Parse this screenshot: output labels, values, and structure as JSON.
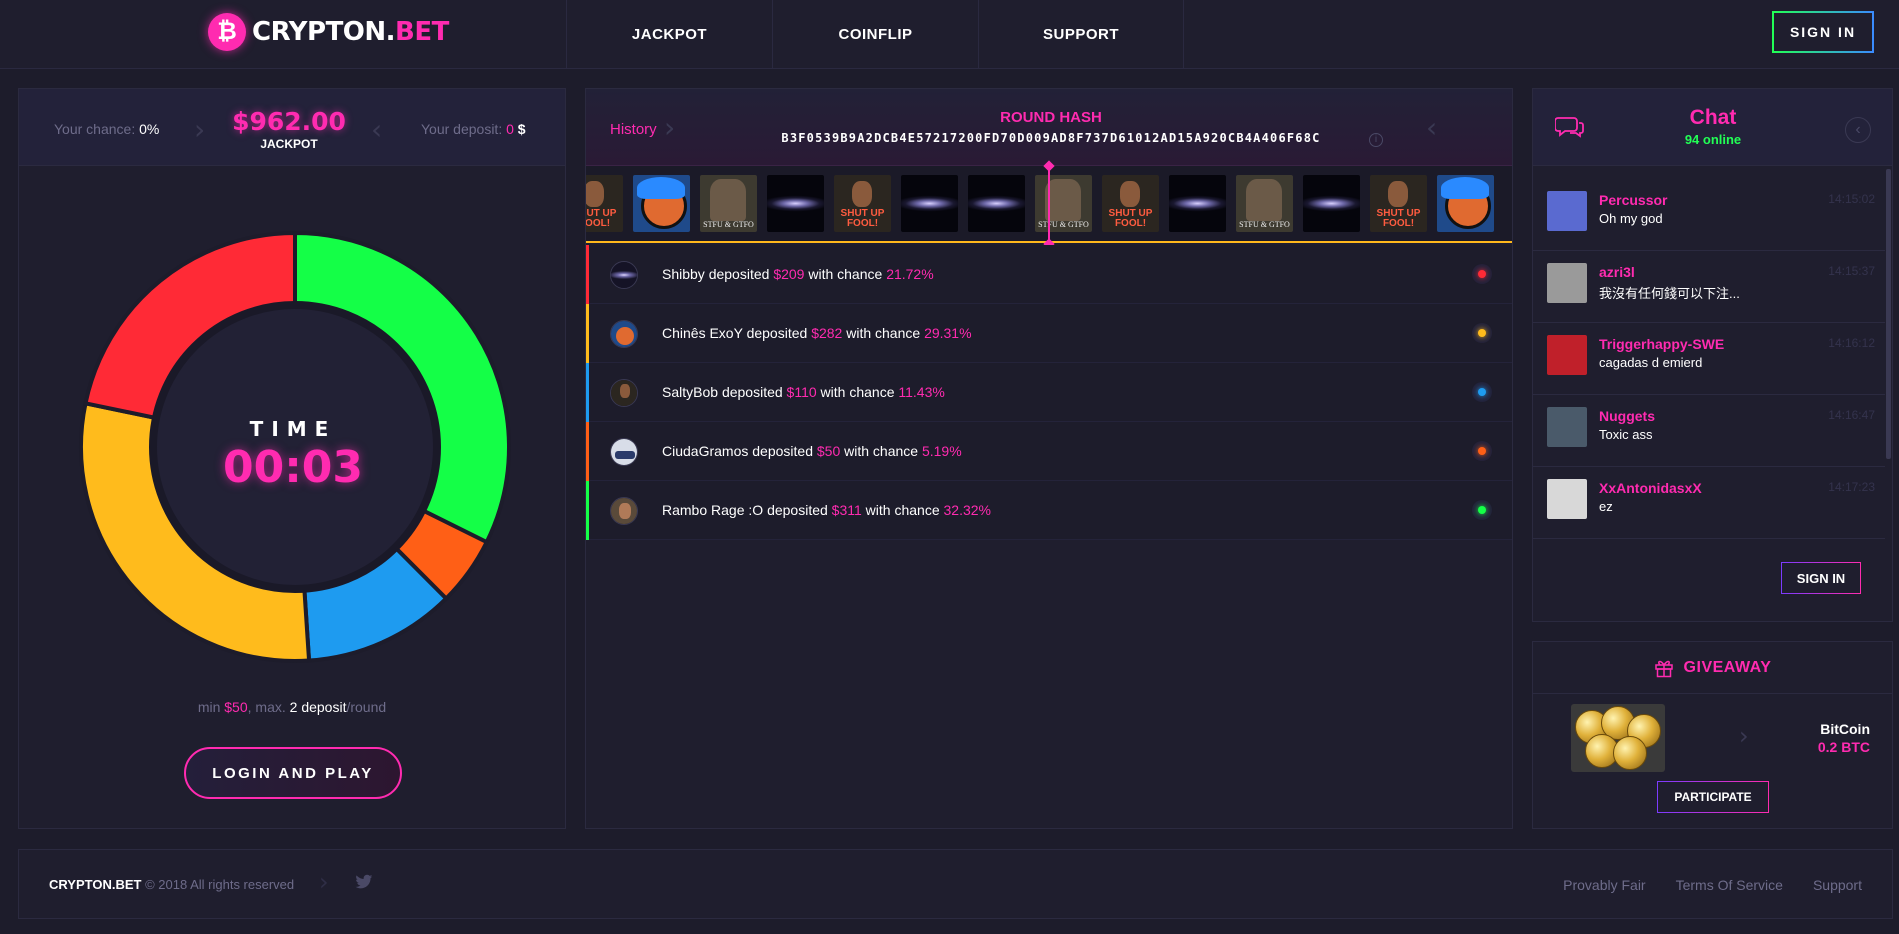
{
  "header": {
    "logo_text": "CRYPTON.",
    "logo_accent": "BET",
    "logo_coin": "₿",
    "nav": [
      "JACKPOT",
      "COINFLIP",
      "SUPPORT"
    ],
    "sign_in": "SIGN IN"
  },
  "jackpot": {
    "your_chance_label": "Your chance:",
    "your_chance_value": "0%",
    "amount": "$962.00",
    "amount_label": "JACKPOT",
    "your_deposit_label": "Your deposit:",
    "your_deposit_value": "0",
    "your_deposit_currency": "$",
    "timer_label": "TIME",
    "timer_value": "00:03",
    "rules_min_label": "min",
    "rules_min_value": "$50",
    "rules_max_label": ", max.",
    "rules_max_value": "2 deposit",
    "rules_suffix": "/round",
    "login_button": "LOGIN AND PLAY",
    "wheel_segments": [
      {
        "name": "Rambo Rage :O",
        "percent": 32.32,
        "color": "#14ff47"
      },
      {
        "name": "CiudaGramos",
        "percent": 5.19,
        "color": "#ff5f16"
      },
      {
        "name": "SaltyBob",
        "percent": 11.43,
        "color": "#1e9bf0"
      },
      {
        "name": "Chinês ExoY",
        "percent": 29.31,
        "color": "#ffbb1c"
      },
      {
        "name": "Shibby",
        "percent": 21.72,
        "color": "#ff2a36"
      }
    ]
  },
  "round": {
    "history_label": "History",
    "hash_label": "ROUND HASH",
    "hash": "B3F0539B9A2DCB4E57217200FD70D009AD8F737D61012AD15A920CB4A406F68C",
    "info_icon": "i",
    "carousel": [
      "fool",
      "face",
      "stfu",
      "galaxy",
      "fool",
      "galaxy",
      "galaxy",
      "stfu",
      "fool",
      "galaxy",
      "stfu",
      "galaxy",
      "fool",
      "face"
    ]
  },
  "deposits": [
    {
      "name": "Shibby",
      "verb": "deposited",
      "amount": "$209",
      "with": "with chance",
      "chance": "21.72%",
      "color": "#ff2a36",
      "avatar": "galaxy"
    },
    {
      "name": "Chinês ExoY",
      "verb": "deposited",
      "amount": "$282",
      "with": "with chance",
      "chance": "29.31%",
      "color": "#ffbb1c",
      "avatar": "face"
    },
    {
      "name": "SaltyBob",
      "verb": "deposited",
      "amount": "$110",
      "with": "with chance",
      "chance": "11.43%",
      "color": "#1e9bf0",
      "avatar": "fool"
    },
    {
      "name": "CiudaGramos",
      "verb": "deposited",
      "amount": "$50",
      "with": "with chance",
      "chance": "5.19%",
      "color": "#ff5f16",
      "avatar": "car"
    },
    {
      "name": "Rambo Rage :O",
      "verb": "deposited",
      "amount": "$311",
      "with": "with chance",
      "chance": "32.32%",
      "color": "#14ff47",
      "avatar": "stfu"
    }
  ],
  "chat": {
    "title": "Chat",
    "online": "94 online",
    "collapse_icon": "‹",
    "messages": [
      {
        "user": "Percussor",
        "text": "Oh my god",
        "time": "14:15:02",
        "avatar_color": "#5a6ad0"
      },
      {
        "user": "azri3l",
        "text": "我沒有任何錢可以下注...",
        "time": "14:15:37",
        "avatar_color": "#9a9a9a"
      },
      {
        "user": "Triggerhappy-SWE",
        "text": "cagadas d emierd",
        "time": "14:16:12",
        "avatar_color": "#c0202a"
      },
      {
        "user": "Nuggets",
        "text": "Toxic ass",
        "time": "14:16:47",
        "avatar_color": "#4a5a6a"
      },
      {
        "user": "XxAntonidasxX",
        "text": "ez",
        "time": "14:17:23",
        "avatar_color": "#d8d8d8"
      }
    ],
    "sign_in": "SIGN IN"
  },
  "giveaway": {
    "title": "GIVEAWAY",
    "item_name": "BitCoin",
    "item_amount": "0.2 BTC",
    "participate": "PARTICIPATE"
  },
  "footer": {
    "brand": "CRYPTON.BET",
    "copyright": "© 2018 All rights reserved",
    "links": [
      "Provably Fair",
      "Terms Of Service",
      "Support"
    ]
  }
}
